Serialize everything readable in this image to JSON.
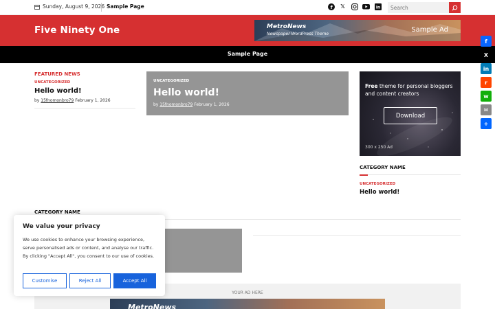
{
  "topbar": {
    "date": "Sunday, August 9, 2026",
    "link": "Sample Page",
    "search_placeholder": "Search",
    "social": [
      "facebook-icon",
      "x-icon",
      "instagram-icon",
      "youtube-icon",
      "linkedin-icon"
    ]
  },
  "header": {
    "site_title": "Five Ninety One",
    "ad": {
      "brand": "MetroNews",
      "tagline": "Newspaper WordPress Theme",
      "label": "Sample Ad"
    }
  },
  "nav": {
    "items": [
      "Sample Page"
    ]
  },
  "featured": {
    "label": "FEATURED NEWS",
    "category": "UNCATEGORIZED",
    "title": "Hello world!",
    "by": "by",
    "author": "15fnomonbro79",
    "date": "February 1, 2026"
  },
  "hero": {
    "category": "UNCATEGORIZED",
    "title": "Hello world!",
    "by": "by",
    "author": "15fnomonbro79",
    "date": "February 1, 2026"
  },
  "sidebar": {
    "ad": {
      "text_bold": "Free",
      "text": " theme for personal bloggers and content creators",
      "button": "Download",
      "size": "300 x 250 Ad"
    },
    "category_title": "CATEGORY NAME",
    "category": "UNCATEGORIZED",
    "post_title": "Hello world!"
  },
  "lower": {
    "category_title": "CATEGORY NAME"
  },
  "bottom_ad": {
    "label": "YOUR AD HERE",
    "brand": "MetroNews"
  },
  "share": [
    {
      "icon": "facebook-icon",
      "color": "#0866ff",
      "glyph": "f"
    },
    {
      "icon": "x-icon",
      "color": "#000000",
      "glyph": "X"
    },
    {
      "icon": "linkedin-icon",
      "color": "#007bb5",
      "glyph": "in"
    },
    {
      "icon": "reddit-icon",
      "color": "#ff4500",
      "glyph": "r"
    },
    {
      "icon": "whatsapp-icon",
      "color": "#12af0a",
      "glyph": "w"
    },
    {
      "icon": "email-icon",
      "color": "#888888",
      "glyph": "✉"
    },
    {
      "icon": "share-icon",
      "color": "#0166ff",
      "glyph": "+"
    }
  ],
  "cookie": {
    "title": "We value your privacy",
    "description": "We use cookies to enhance your browsing experience, serve personalised ads or content, and analyse our traffic. By clicking \"Accept All\", you consent to our use of cookies.",
    "customise": "Customise",
    "reject": "Reject All",
    "accept": "Accept All"
  },
  "colors": {
    "brand_red": "#d63031",
    "cookie_blue": "#1863dc"
  }
}
